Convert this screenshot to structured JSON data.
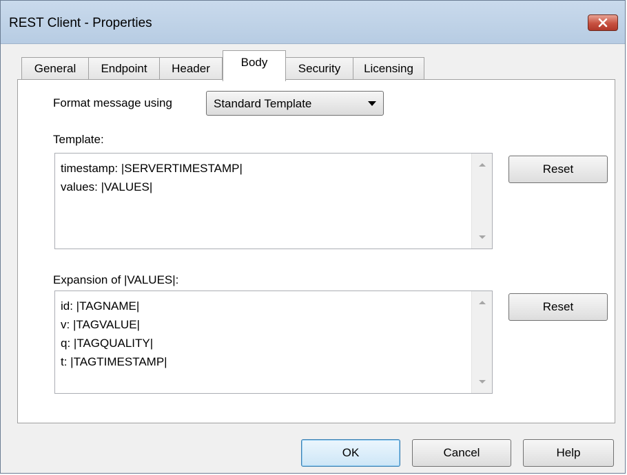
{
  "window": {
    "title": "REST Client - Properties"
  },
  "tabs": [
    {
      "label": "General",
      "active": false
    },
    {
      "label": "Endpoint",
      "active": false
    },
    {
      "label": "Header",
      "active": false
    },
    {
      "label": "Body",
      "active": true
    },
    {
      "label": "Security",
      "active": false
    },
    {
      "label": "Licensing",
      "active": false
    }
  ],
  "body": {
    "format_label": "Format message using",
    "format_value": "Standard Template",
    "template_label": "Template:",
    "template_lines": [
      "timestamp: |SERVERTIMESTAMP|",
      "values: |VALUES|"
    ],
    "template_reset_label": "Reset",
    "expansion_label": "Expansion of |VALUES|:",
    "expansion_lines": [
      "id: |TAGNAME|",
      "v: |TAGVALUE|",
      "q: |TAGQUALITY|",
      "t: |TAGTIMESTAMP|"
    ],
    "expansion_reset_label": "Reset"
  },
  "footer": {
    "ok_label": "OK",
    "cancel_label": "Cancel",
    "help_label": "Help"
  },
  "colors": {
    "close_button": "#c75140",
    "titlebar": "#c9daec",
    "default_button_border": "#3c7fb1"
  }
}
